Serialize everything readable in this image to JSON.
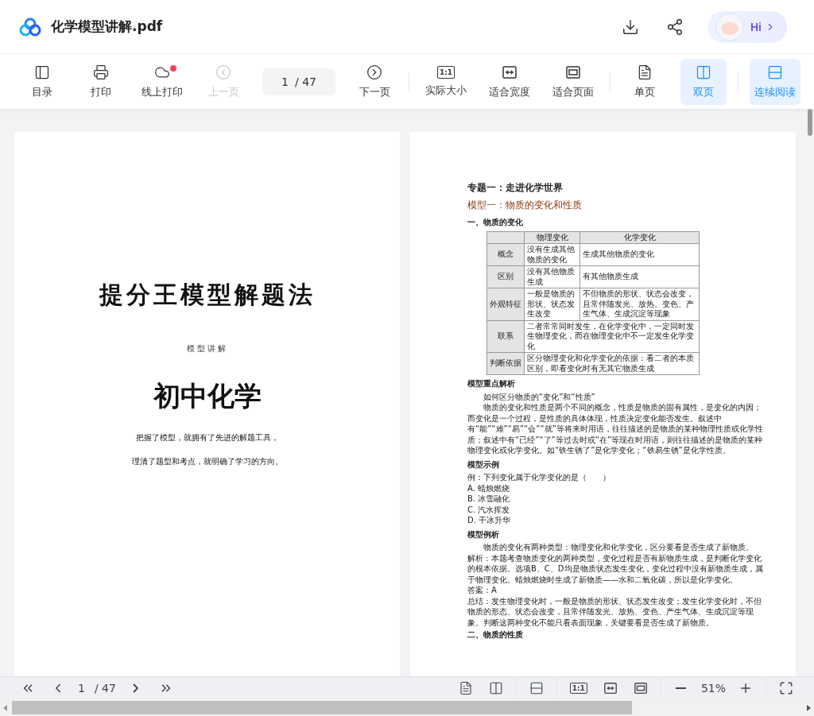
{
  "header": {
    "title": "化学模型讲解.pdf",
    "assistant": {
      "label": "Hi"
    }
  },
  "toolbar": {
    "items": [
      {
        "kind": "button",
        "label": "目录",
        "disabled": false,
        "selected": false,
        "badge": false
      },
      {
        "kind": "button",
        "label": "打印",
        "disabled": false,
        "selected": false,
        "badge": false
      },
      {
        "kind": "button",
        "label": "线上打印",
        "disabled": false,
        "selected": false,
        "badge": true
      },
      {
        "kind": "button",
        "label": "上一页",
        "disabled": true,
        "selected": false,
        "badge": false
      },
      {
        "kind": "page",
        "current": "1",
        "total": "/ 47"
      },
      {
        "kind": "button",
        "label": "下一页",
        "disabled": false,
        "selected": false,
        "badge": false
      },
      {
        "kind": "divider"
      },
      {
        "kind": "button",
        "label": "实际大小",
        "icon_text": "1:1",
        "disabled": false,
        "selected": false,
        "badge": false
      },
      {
        "kind": "button",
        "label": "适合宽度",
        "disabled": false,
        "selected": false,
        "badge": false
      },
      {
        "kind": "button",
        "label": "适合页面",
        "disabled": false,
        "selected": false,
        "badge": false
      },
      {
        "kind": "divider"
      },
      {
        "kind": "button",
        "label": "单页",
        "disabled": false,
        "selected": false,
        "badge": false
      },
      {
        "kind": "button",
        "label": "双页",
        "disabled": false,
        "selected": true,
        "badge": false
      },
      {
        "kind": "divider"
      },
      {
        "kind": "button",
        "label": "连续阅读",
        "disabled": false,
        "selected": true,
        "badge": false
      }
    ]
  },
  "cover": {
    "title": "提分王模型解题法",
    "subtitle": "模型讲解",
    "main_title": "初中化学",
    "lines": [
      "把握了模型，就拥有了先进的解题工具，",
      "理清了题型和考点，就明确了学习的方向。"
    ]
  },
  "page": {
    "blocks": [
      {
        "kind": "topic",
        "text": "专题一：走进化学世界"
      },
      {
        "kind": "model",
        "text": "模型一：物质的变化和性质"
      },
      {
        "kind": "heading",
        "text": "一、物质的变化"
      },
      {
        "kind": "table",
        "columns": [
          "物理变化",
          "化学变化"
        ],
        "rows": [
          {
            "label": "概念",
            "cells": [
              {
                "text": "没有生成其他物质的变化"
              },
              {
                "text": "生成其他物质的变化"
              }
            ]
          },
          {
            "label": "区别",
            "cells": [
              {
                "text": "没有其他物质生成"
              },
              {
                "text": "有其他物质生成"
              }
            ]
          },
          {
            "label": "外观特征",
            "cells": [
              {
                "text": "一般是物质的形状、状态发生改变"
              },
              {
                "text": "不但物质的形状、状态会改变，且常伴随发光、放热、变色、产生气体、生成沉淀等现象"
              }
            ]
          },
          {
            "label": "联系",
            "cells": [
              {
                "text": "二者常常同时发生，在化学变化中，一定同时发生物理变化，而在物理变化中不一定发生化学变化",
                "colspan": 2
              }
            ]
          },
          {
            "label": "判断依据",
            "cells": [
              {
                "text": "区分物理变化和化学变化的依据：看二者的本质区别，即看变化时有无其它物质生成",
                "colspan": 2
              }
            ]
          }
        ]
      },
      {
        "kind": "subheading",
        "text": "模型重点解析"
      },
      {
        "kind": "para",
        "text": "如何区分物质的“变化”和“性质”"
      },
      {
        "kind": "para",
        "text": "物质的变化和性质是两个不同的概念，性质是物质的固有属性，是变化的内因；而变化是一个过程，是性质的具体体现，性质决定变化能否发生。叙述中有“能”“难”“易”“会”“就”等将来时用语，往往描述的是物质的某种物理性质或化学性质；叙述中有“已经”“了”等过去时或“在”等现在时用语，则往往描述的是物质的某种物理变化或化学变化。如“铁生锈了”是化学变化；“铁易生锈”是化学性质。"
      },
      {
        "kind": "subheading",
        "text": "模型示例"
      },
      {
        "kind": "line",
        "text": "例：下列变化属于化学变化的是（　　）"
      },
      {
        "kind": "line",
        "text": "A. 蜡烛燃烧"
      },
      {
        "kind": "line",
        "text": "B. 冰雪融化"
      },
      {
        "kind": "line",
        "text": "C. 汽水挥发"
      },
      {
        "kind": "line",
        "text": "D. 干冰升华"
      },
      {
        "kind": "subheading",
        "text": "模型例析"
      },
      {
        "kind": "para",
        "text": "物质的变化有两种类型：物理变化和化学变化，区分要看是否生成了新物质。"
      },
      {
        "kind": "line",
        "text": "解析：本题考查物质变化的两种类型，变化过程是否有新物质生成，是判断化学变化的根本依据。选项B、C、D均是物质状态发生变化，变化过程中没有新物质生成，属于物理变化。蜡烛燃烧时生成了新物质——水和二氧化碳，所以是化学变化。"
      },
      {
        "kind": "line",
        "text": "答案：A"
      },
      {
        "kind": "line",
        "text": "总结：发生物理变化时，一般是物质的形状、状态发生改变；发生化学变化时，不但物质的形态、状态会改变，且常伴随发光、放热、变色、产生气体、生成沉淀等现象。判断这两种变化不能只看表面现象，关键要看是否生成了新物质。"
      },
      {
        "kind": "heading",
        "text": "二、物质的性质"
      }
    ]
  },
  "bottom_bar": {
    "page": "1",
    "total": "/ 47",
    "zoom": "51%",
    "actual_size": "1:1"
  }
}
